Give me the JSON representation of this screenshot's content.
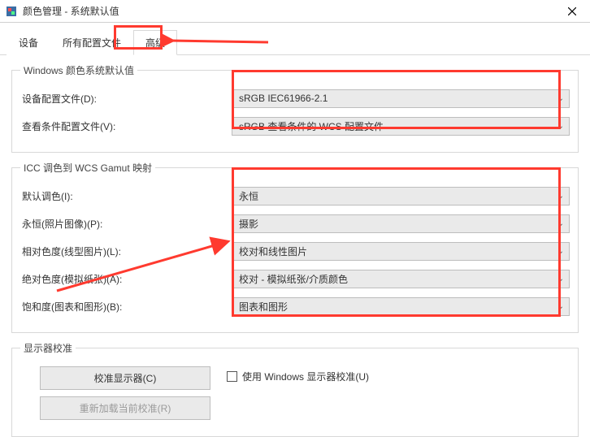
{
  "window": {
    "title": "颜色管理 - 系统默认值"
  },
  "tabs": {
    "t0": "设备",
    "t1": "所有配置文件",
    "t2": "高级"
  },
  "group1": {
    "legend": "Windows 颜色系统默认值",
    "row1_label": "设备配置文件(D):",
    "row1_value": "sRGB IEC61966-2.1",
    "row2_label": "查看条件配置文件(V):",
    "row2_value": "sRGB 查看条件的 WCS 配置文件"
  },
  "group2": {
    "legend": "ICC 调色到 WCS Gamut 映射",
    "r1_label": "默认调色(I):",
    "r1_value": "永恒",
    "r2_label": "永恒(照片图像)(P):",
    "r2_value": "摄影",
    "r3_label": "相对色度(线型图片)(L):",
    "r3_value": "校对和线性图片",
    "r4_label": "绝对色度(模拟纸张)(A):",
    "r4_value": "校对 - 模拟纸张/介质颜色",
    "r5_label": "饱和度(图表和图形)(B):",
    "r5_value": "图表和图形"
  },
  "group3": {
    "legend": "显示器校准",
    "btn_calibrate": "校准显示器(C)",
    "cb_label": "使用 Windows 显示器校准(U)",
    "btn_reload": "重新加载当前校准(R)"
  }
}
